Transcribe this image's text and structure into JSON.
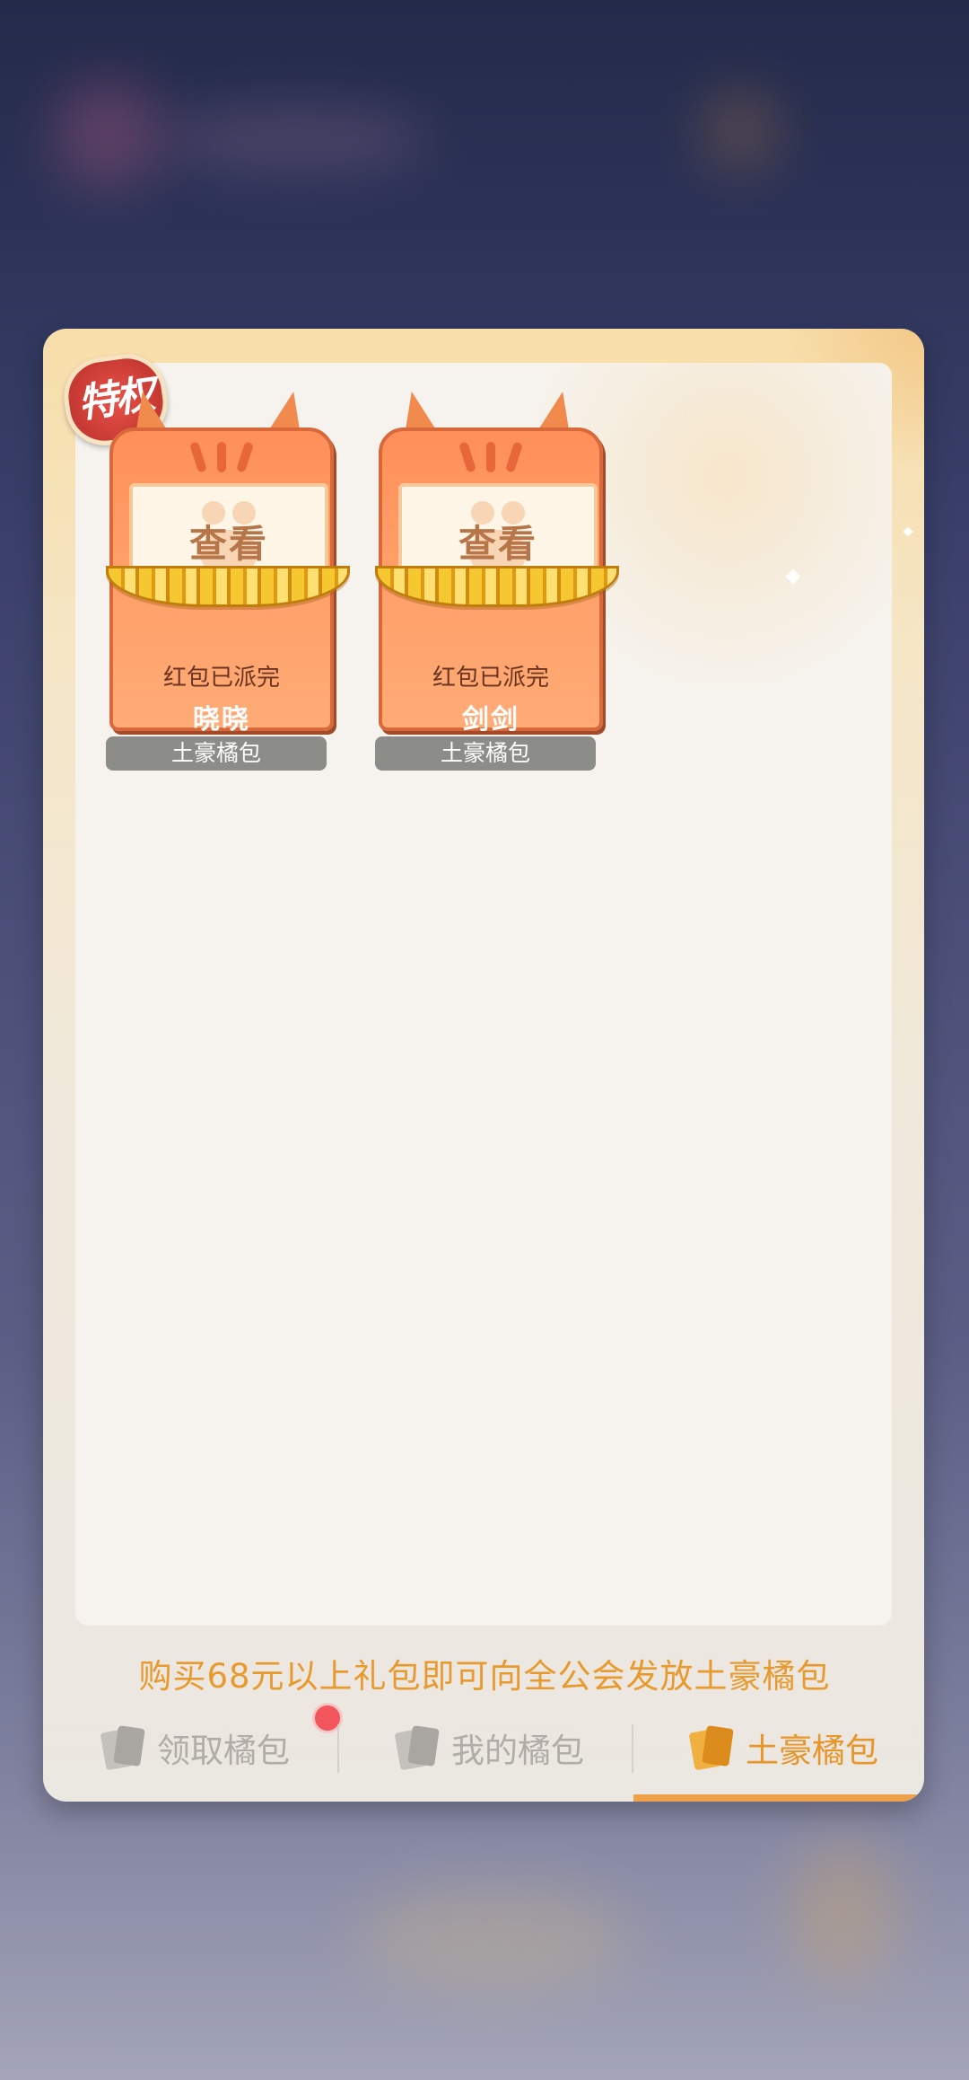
{
  "privilege_badge": "特权",
  "cards": [
    {
      "view_label": "查看",
      "status": "红包已派完",
      "owner": "晓晓",
      "tag": "土豪橘包"
    },
    {
      "view_label": "查看",
      "status": "红包已派完",
      "owner": "剑剑",
      "tag": "土豪橘包"
    }
  ],
  "notice": "购买68元以上礼包即可向全公会发放土豪橘包",
  "tabs": [
    {
      "label": "领取橘包",
      "icon": "cat-card-icon",
      "active": false,
      "has_dot": true
    },
    {
      "label": "我的橘包",
      "icon": "card-stack-icon",
      "active": false,
      "has_dot": false
    },
    {
      "label": "土豪橘包",
      "icon": "card-stack-icon",
      "active": true,
      "has_dot": false
    }
  ],
  "colors": {
    "accent": "#e8952a",
    "card": "#ff9d66",
    "tag": "#8c8c88"
  }
}
